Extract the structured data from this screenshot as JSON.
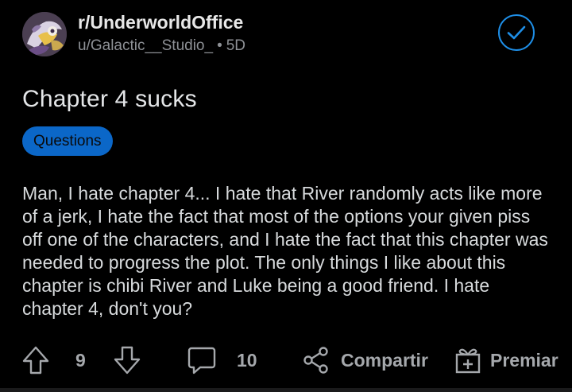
{
  "post": {
    "subreddit": "r/UnderworldOffice",
    "author": "u/Galactic__Studio_",
    "separator": "•",
    "age": "5D",
    "title": "Chapter 4 sucks",
    "flair": "Questions",
    "body": "Man, I hate chapter 4... I hate that River randomly acts like more of a jerk, I hate the fact that most of the options your given piss off one of the characters, and I hate the fact that this chapter was needed to progress the plot. The only things I like about this chapter is chibi River and Luke being a good friend. I hate chapter 4, don't you?"
  },
  "actions": {
    "vote_count": "9",
    "comment_count": "10",
    "share_label": "Compartir",
    "award_label": "Premiar"
  },
  "colors": {
    "background": "#000000",
    "accent": "#1e8ee6",
    "flair_bg": "#0b67c8",
    "muted": "#8e9196",
    "text": "#d7dadc"
  },
  "icons": {
    "joined": "check-circle-icon",
    "upvote": "arrow-up-icon",
    "downvote": "arrow-down-icon",
    "comment": "comment-bubble-icon",
    "share": "share-icon",
    "award": "gift-icon"
  }
}
